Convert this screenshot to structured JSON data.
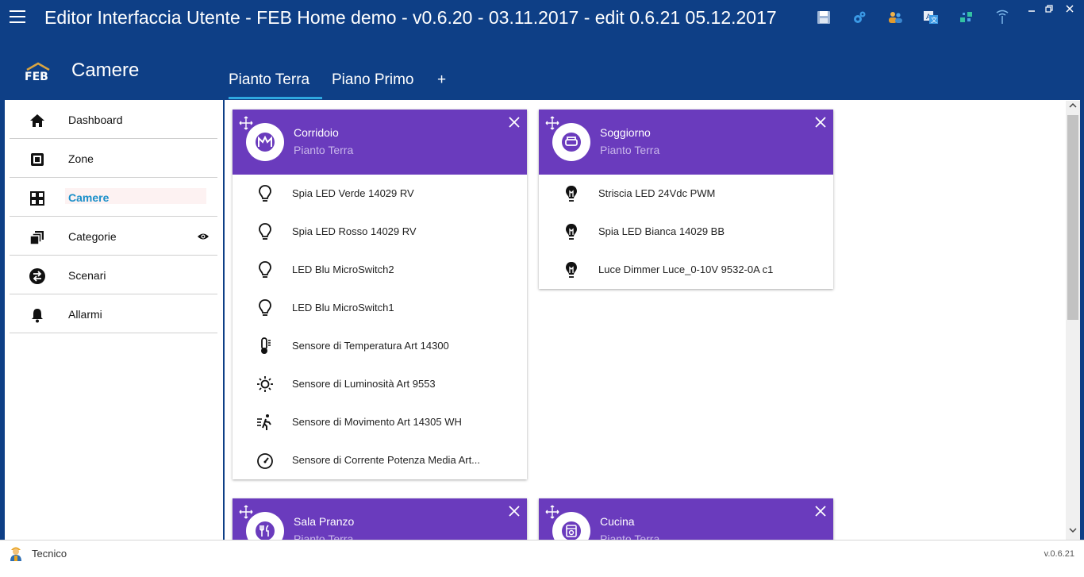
{
  "app": {
    "title": "Editor Interfaccia Utente - FEB Home demo - v0.6.20 - 03.11.2017 - edit 0.6.21 05.12.2017",
    "toolbar_icons": [
      "save-icon",
      "settings-icon",
      "users-icon",
      "translate-icon",
      "network-icon",
      "antenna-icon"
    ],
    "window_controls": [
      "minimize",
      "restore",
      "close"
    ]
  },
  "header": {
    "logo_text": "FEB",
    "section_title": "Camere",
    "tabs": [
      {
        "label": "Pianto Terra",
        "active": true
      },
      {
        "label": "Piano Primo",
        "active": false
      }
    ],
    "add_tab_label": "+"
  },
  "sidebar": {
    "items": [
      {
        "label": "Dashboard",
        "icon": "home-icon"
      },
      {
        "label": "Zone",
        "icon": "zone-icon"
      },
      {
        "label": "Camere",
        "icon": "grid-icon",
        "active": true
      },
      {
        "label": "Categorie",
        "icon": "layers-icon",
        "visibility_icon": "eye-icon"
      },
      {
        "label": "Scenari",
        "icon": "swap-icon"
      },
      {
        "label": "Allarmi",
        "icon": "bell-icon"
      }
    ]
  },
  "rooms": [
    {
      "title": "Corridoio",
      "floor": "Pianto Terra",
      "icon": "corridor-icon",
      "items": [
        {
          "label": "Spia LED Verde 14029 RV",
          "icon": "bulb-icon"
        },
        {
          "label": "Spia LED Rosso 14029 RV",
          "icon": "bulb-icon"
        },
        {
          "label": "LED Blu MicroSwitch2",
          "icon": "bulb-icon"
        },
        {
          "label": "LED Blu MicroSwitch1",
          "icon": "bulb-icon"
        },
        {
          "label": "Sensore di Temperatura Art 14300",
          "icon": "thermometer-icon"
        },
        {
          "label": "Sensore di Luminosità Art 9553",
          "icon": "sun-icon"
        },
        {
          "label": "Sensore di Movimento Art 14305 WH",
          "icon": "motion-icon"
        },
        {
          "label": "Sensore di Corrente Potenza Media Art...",
          "icon": "gauge-icon"
        }
      ]
    },
    {
      "title": "Soggiorno",
      "floor": "Pianto Terra",
      "icon": "sofa-icon",
      "items": [
        {
          "label": "Striscia LED 24Vdc PWM",
          "icon": "bulb-filament-icon"
        },
        {
          "label": "Spia LED Bianca 14029 BB",
          "icon": "bulb-filament-icon"
        },
        {
          "label": "Luce Dimmer  Luce_0-10V  9532-0A c1",
          "icon": "bulb-filament-icon"
        }
      ]
    },
    {
      "title": "Sala Pranzo",
      "floor": "Pianto Terra",
      "icon": "cutlery-icon",
      "items": []
    },
    {
      "title": "Cucina",
      "floor": "Pianto Terra",
      "icon": "oven-icon",
      "items": []
    }
  ],
  "statusbar": {
    "user": "Tecnico",
    "version": "v.0.6.21"
  },
  "colors": {
    "primary": "#0e3f86",
    "card_header": "#6a3bbd",
    "accent": "#1a8fc9",
    "tab_underline": "#2fa8e0"
  }
}
